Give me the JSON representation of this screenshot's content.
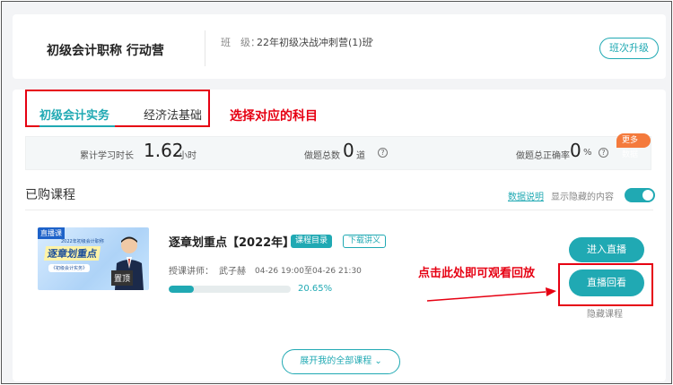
{
  "header": {
    "program_title": "初级会计职称 行动营",
    "class_label": "班　级：",
    "class_value": "22年初级决战冲刺营(1)班",
    "class_chevron": "›",
    "upgrade_button": "班次升级"
  },
  "tabs": [
    {
      "label": "初级会计实务",
      "active": true
    },
    {
      "label": "经济法基础",
      "active": false
    }
  ],
  "annotations": {
    "select_subject": "选择对应的科目",
    "click_replay": "点击此处即可观看回放"
  },
  "stats": {
    "study_time": {
      "label": "累计学习时长",
      "value": "1.62",
      "unit": "小时"
    },
    "question_count": {
      "label": "做题总数",
      "value": "0",
      "unit": "道"
    },
    "accuracy": {
      "label": "做题总正确率",
      "value": "0",
      "unit": "%"
    },
    "more_data_badge": "更多数据"
  },
  "purchased": {
    "section_title": "已购课程",
    "data_note": "数据说明",
    "show_hidden_label": "显示隐藏的内容",
    "show_hidden_enabled": true
  },
  "course": {
    "thumbnail": {
      "live_tag": "直播课",
      "subtitle": "2022年初级会计职称",
      "headline": "逐章划重点",
      "course_name": "《初级会计实务》",
      "pin_label": "置顶"
    },
    "title": "逐章划重点【2022年】",
    "catalog_tag": "课程目录",
    "handout_tag": "下载讲义",
    "teacher_label": "授课讲师：",
    "teacher_name": "武子赫",
    "time": "04-26 19:00至04-26 21:30",
    "progress_percent": 20.65,
    "progress_text": "20.65%",
    "enter_live_button": "进入直播",
    "replay_button": "直播回看",
    "hide_course": "隐藏课程"
  },
  "expand_button": "展开我的全部课程  ⌄",
  "colors": {
    "accent": "#20a9b3",
    "annotation_red": "#e60012",
    "badge_orange": "#f47a3c"
  }
}
